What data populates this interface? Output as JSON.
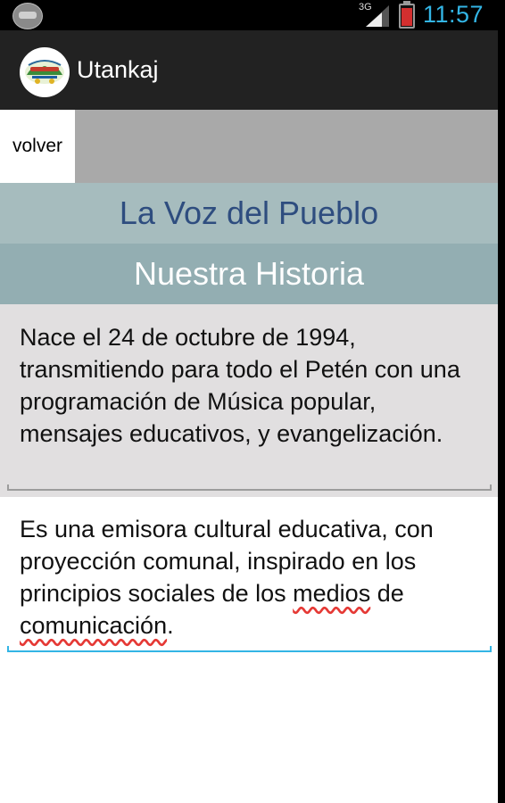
{
  "status_bar": {
    "network": "3G",
    "time": "11:57",
    "battery_color": "#d32f2f",
    "accent_color": "#33b5e5"
  },
  "action_bar": {
    "title": "Utankaj",
    "logo_icon": "app-logo-icon"
  },
  "nav": {
    "back_label": "volver"
  },
  "header": {
    "station_name": "La Voz del Pueblo",
    "section_title": "Nuestra Historia"
  },
  "content": {
    "history_paragraph": "Nace el 24 de octubre de 1994, transmitiendo para todo el Petén con una programación de Música popular, mensajes educativos, y evangelización.",
    "mission_start": "Es una emisora cultural educativa, con proyección comunal, inspirado en los principios sociales de los ",
    "mission_word_1": "medios",
    "mission_mid": " de ",
    "mission_word_2": "comunicación",
    "mission_end": "."
  }
}
